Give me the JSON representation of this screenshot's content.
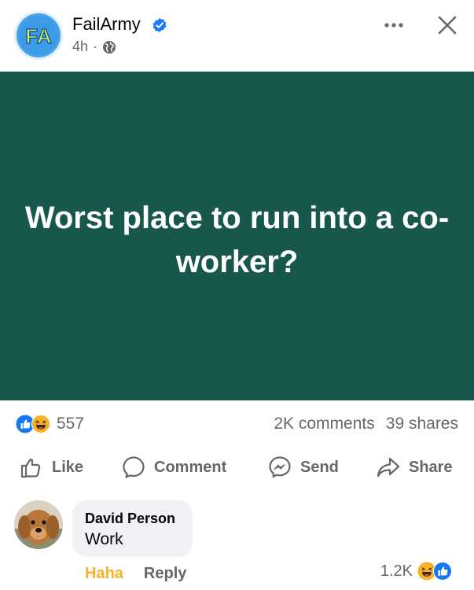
{
  "header": {
    "page_name": "FailArmy",
    "avatar_letters": "FA",
    "time": "4h",
    "separator": "·"
  },
  "post": {
    "text": "Worst place to run into a co-worker?",
    "background_color": "#17574c"
  },
  "stats": {
    "reaction_count": "557",
    "comments": "2K comments",
    "shares": "39 shares"
  },
  "actions": {
    "like": "Like",
    "comment": "Comment",
    "send": "Send",
    "share": "Share"
  },
  "comment": {
    "author": "David Person",
    "text": "Work",
    "haha": "Haha",
    "reply": "Reply",
    "reaction_count": "1.2K"
  },
  "icons": {
    "more": "more-dots-icon",
    "close": "close-icon",
    "verified": "verified-badge-icon",
    "globe": "globe-icon",
    "like": "thumbs-up-icon",
    "comment": "speech-bubble-icon",
    "send": "messenger-icon",
    "share": "share-arrow-icon"
  },
  "colors": {
    "brand_blue": "#1877f2",
    "muted": "#65676b",
    "haha_yellow": "#f7b125"
  }
}
